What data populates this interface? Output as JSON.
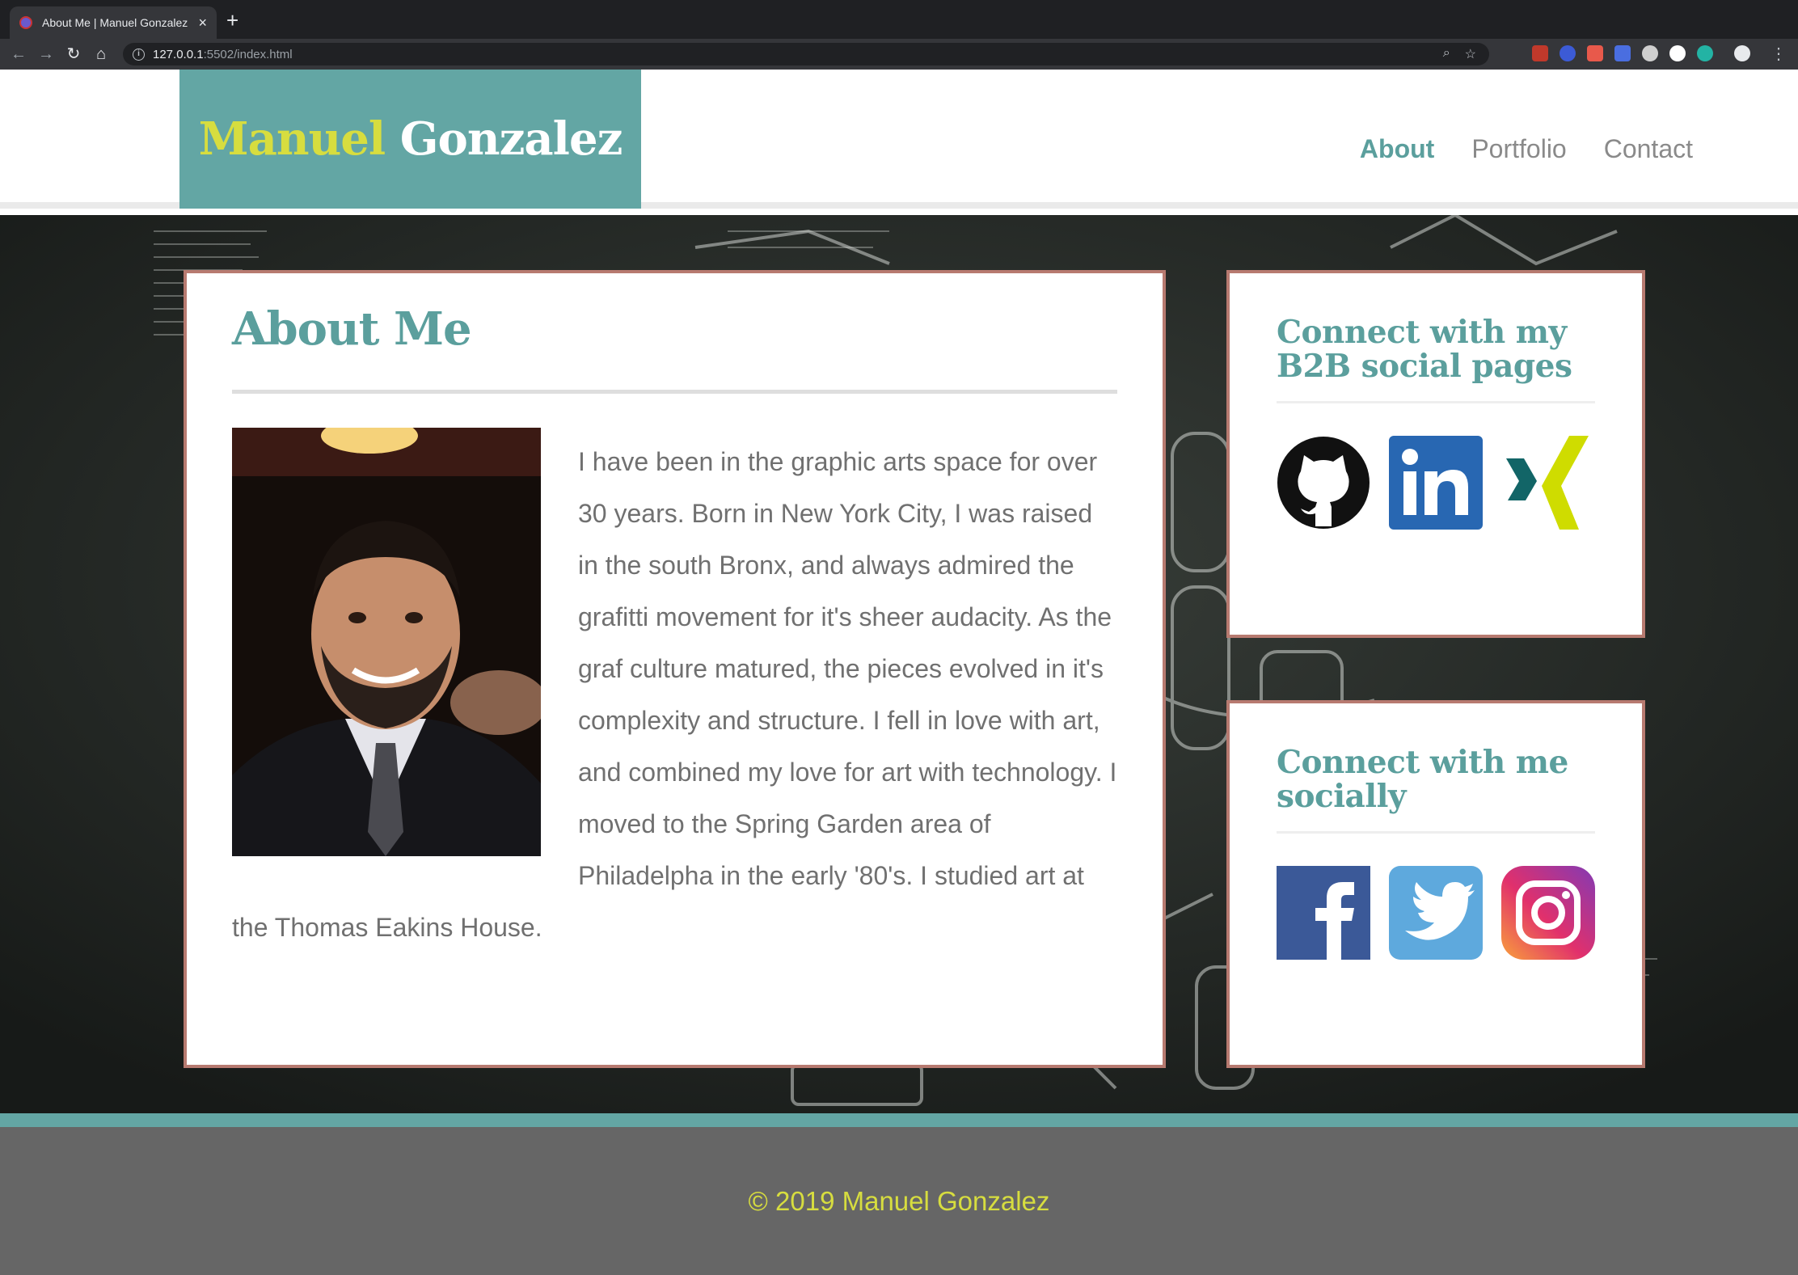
{
  "browser": {
    "tab_title": "About Me | Manuel Gonzalez",
    "url_host": "127.0.0.1",
    "url_path": ":5502/index.html"
  },
  "site": {
    "logo_first": "Manuel",
    "logo_last": "Gonzalez",
    "nav": [
      "About",
      "Portfolio",
      "Contact"
    ],
    "active_nav": "About"
  },
  "about": {
    "title": "About Me",
    "text": "I have been in the graphic arts space for over 30 years. Born in New York City, I was raised in the south Bronx, and always admired the grafitti movement for it's sheer audacity. As the graf culture matured, the pieces evolved in it's complexity and structure. I fell in love with art, and combined my love for art with technology. I moved to the Spring Garden area of Philadelpha in the early '80's. I studied art at the Thomas Eakins House."
  },
  "social_b2b": {
    "title": "Connect with my B2B social pages",
    "icons": [
      "github-icon",
      "linkedin-icon",
      "xing-icon"
    ]
  },
  "social_personal": {
    "title": "Connect with me socially",
    "icons": [
      "facebook-icon",
      "twitter-icon",
      "instagram-icon"
    ]
  },
  "colors": {
    "teal": "#63a6a4",
    "heading_teal": "#5b9f9d",
    "yellow": "#d7dd3f",
    "card_border": "#b77a70",
    "footer_gray": "#666666"
  },
  "footer": {
    "copyright": "© 2019 Manuel Gonzalez"
  }
}
